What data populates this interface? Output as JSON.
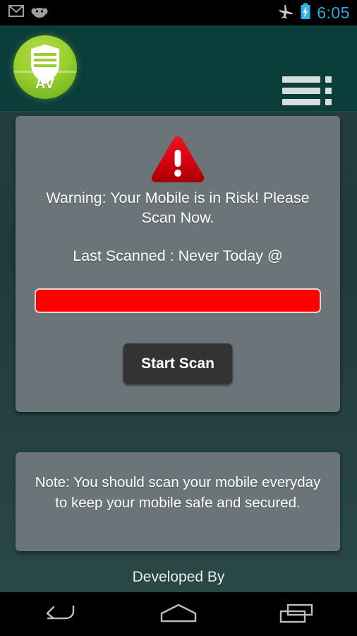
{
  "statusbar": {
    "icons": [
      "gmail-icon",
      "android-jellybean-icon",
      "airplane-mode-icon",
      "battery-charging-icon"
    ],
    "clock": "6:05",
    "clock_color": "#2fa8d8"
  },
  "appbar": {
    "logo": {
      "name": "av-shield-logo",
      "label": "AV",
      "circle_color": "#9bd02f"
    },
    "menu": {
      "name": "menu-icon",
      "label": "Menu"
    }
  },
  "scan_card": {
    "warning_icon": "warning-triangle-icon",
    "warning_color": "#e00000",
    "warning_text": "Warning: Your Mobile is in Risk! Please Scan Now.",
    "last_scanned": "Last Scanned : Never Today @",
    "progress": {
      "value": 100,
      "color": "#ff0000",
      "border_color": "#f2d2d2"
    },
    "start_button": "Start Scan"
  },
  "note_card": {
    "text": "Note: You should scan your mobile everyday to keep your mobile safe and secured."
  },
  "footer": {
    "developed_by": "Developed By"
  },
  "navbar": {
    "back": "back-icon",
    "home": "home-icon",
    "recents": "recent-apps-icon"
  },
  "theme": {
    "background": "#24403f",
    "appbar": "#0b3d3a",
    "card": "#6b7579",
    "button": "#333333"
  }
}
